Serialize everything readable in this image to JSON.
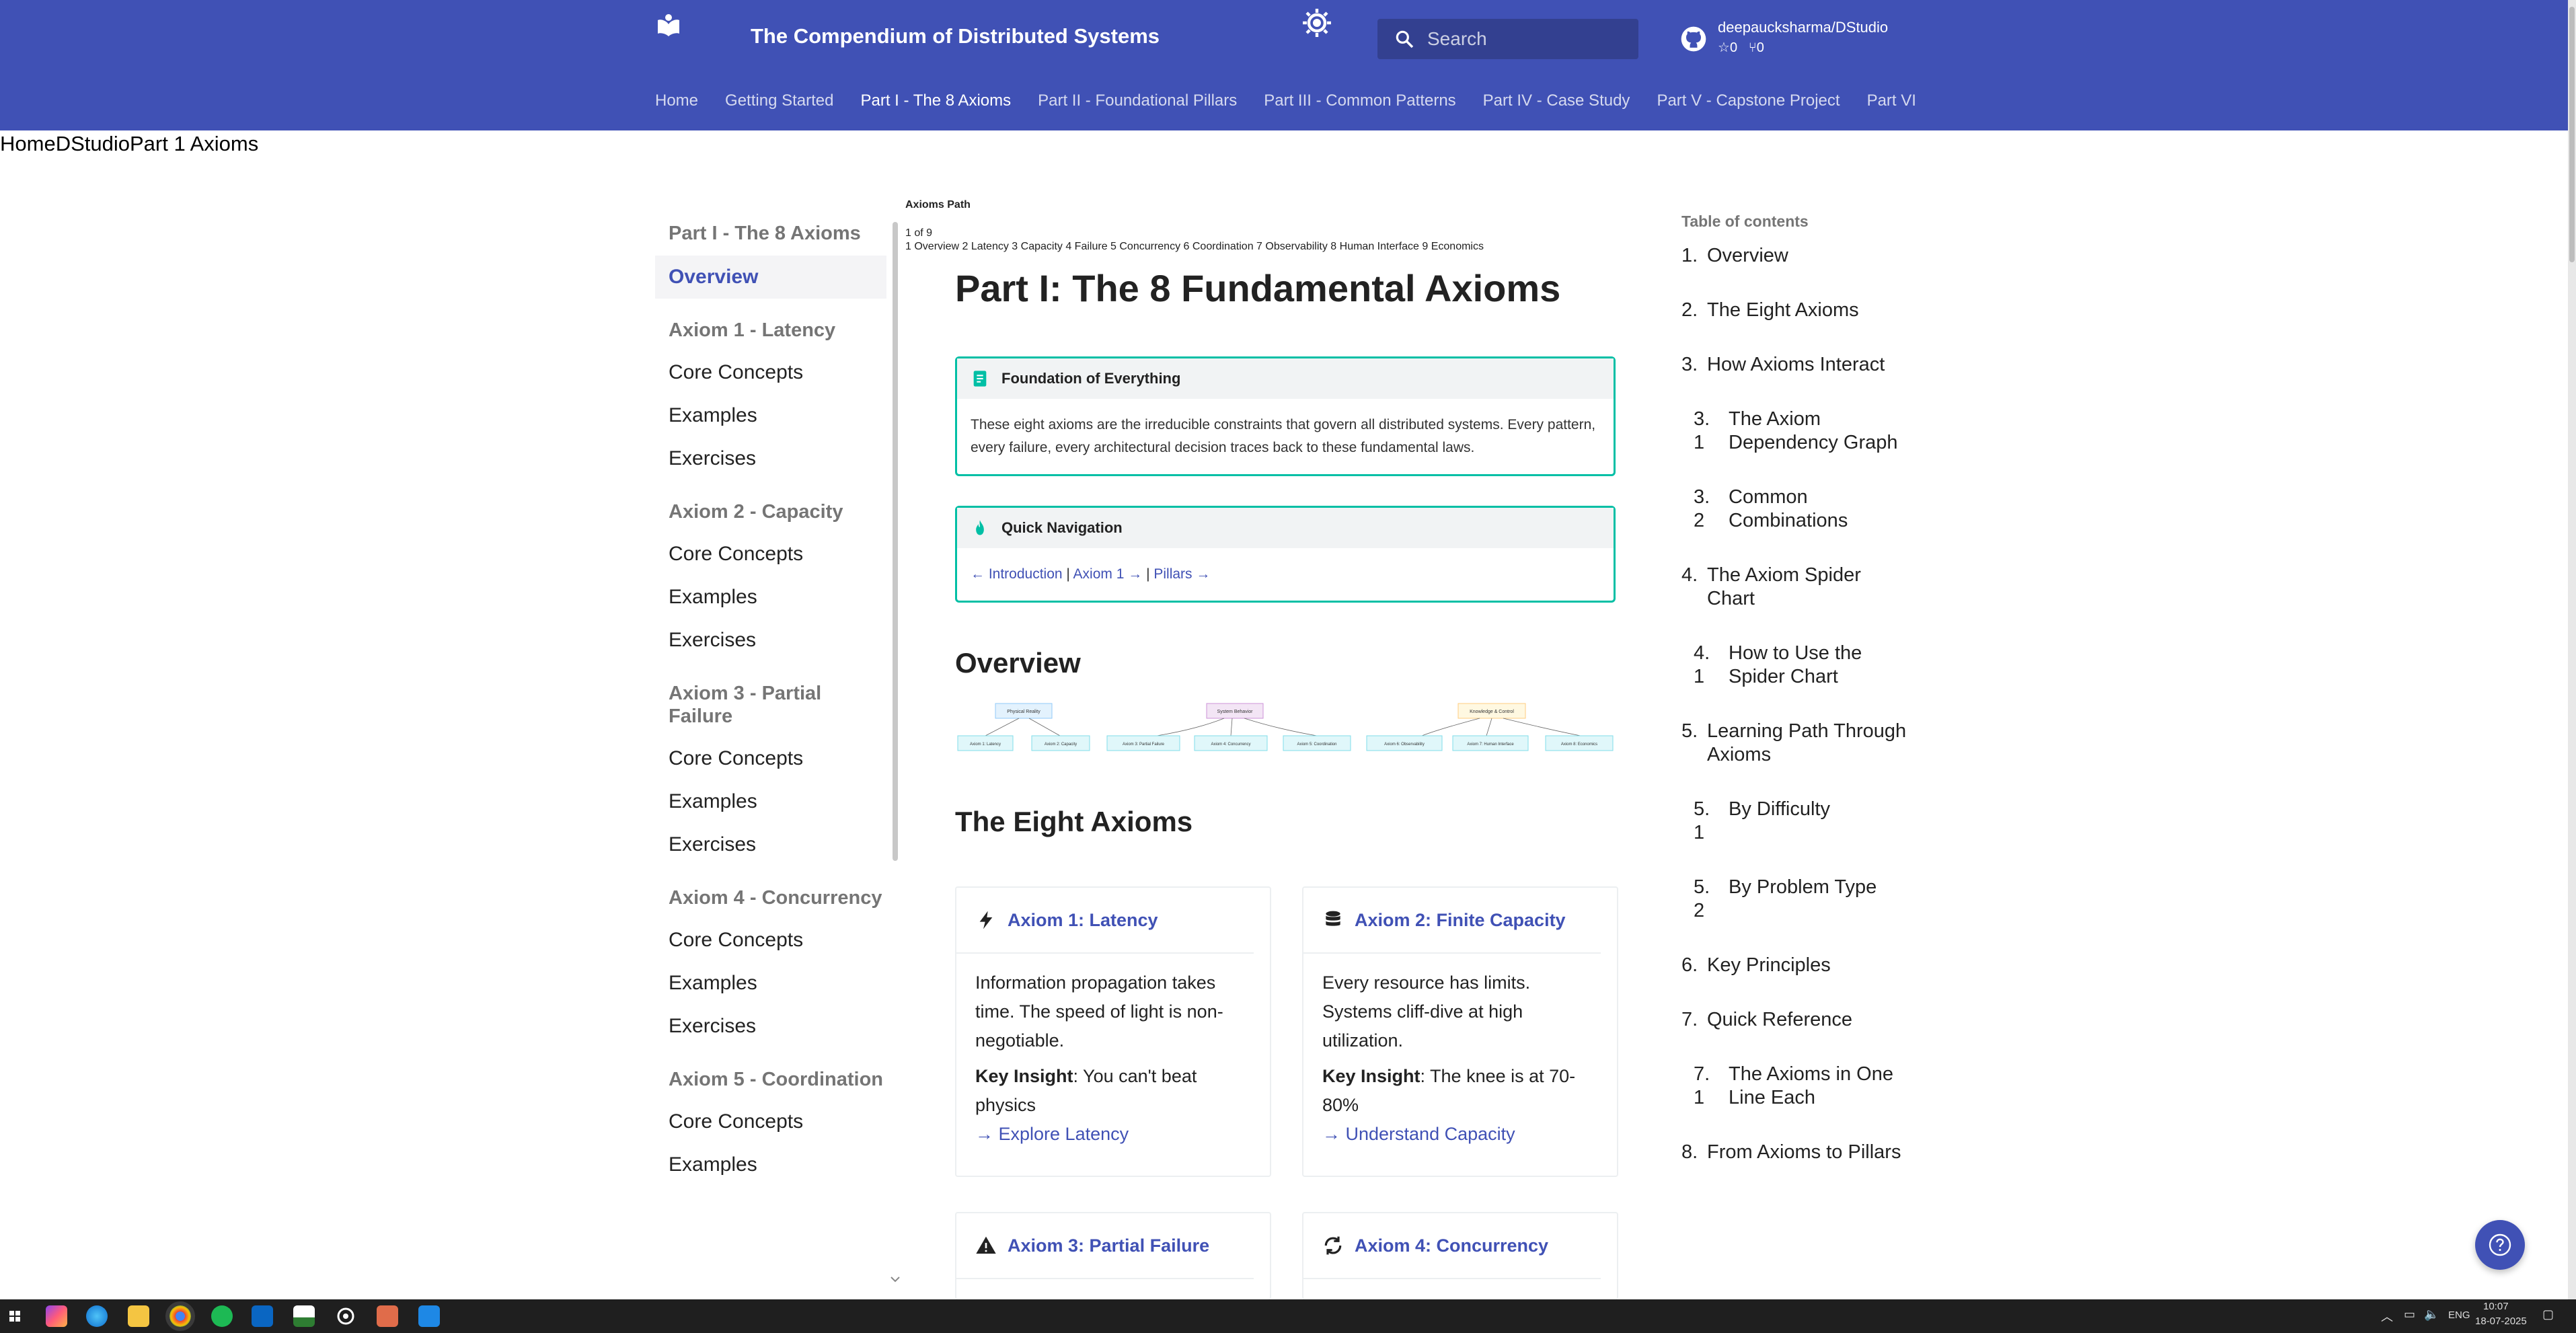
{
  "header": {
    "title": "The Compendium of Distributed Systems",
    "search_placeholder": "Search",
    "repo": {
      "name": "deepaucksharma/DStudio",
      "stars": "0",
      "forks": "0"
    }
  },
  "tabs": [
    {
      "label": "Home"
    },
    {
      "label": "Getting Started"
    },
    {
      "label": "Part I - The 8 Axioms"
    },
    {
      "label": "Part II - Foundational Pillars"
    },
    {
      "label": "Part III - Common Patterns"
    },
    {
      "label": "Part IV - Case Study"
    },
    {
      "label": "Part V - Capstone Project"
    },
    {
      "label": "Part VI"
    }
  ],
  "breadcrumb": "HomeDStudioPart 1 Axioms",
  "sidebar": {
    "section_title": "Part I - The 8 Axioms",
    "overview": "Overview",
    "groups": [
      {
        "title": "Axiom 1 - Latency",
        "items": [
          "Core Concepts",
          "Examples",
          "Exercises"
        ]
      },
      {
        "title": "Axiom 2 - Capacity",
        "items": [
          "Core Concepts",
          "Examples",
          "Exercises"
        ]
      },
      {
        "title": "Axiom 3 - Partial Failure",
        "items": [
          "Core Concepts",
          "Examples",
          "Exercises"
        ]
      },
      {
        "title": "Axiom 4 - Concurrency",
        "items": [
          "Core Concepts",
          "Examples",
          "Exercises"
        ]
      },
      {
        "title": "Axiom 5 - Coordination",
        "items": [
          "Core Concepts",
          "Examples"
        ]
      }
    ]
  },
  "axioms_path": {
    "label": "Axioms Path",
    "count": "1 of 9",
    "steps": "1 Overview 2 Latency 3 Capacity 4 Failure 5 Concurrency 6 Coordination 7 Observability 8 Human Interface 9 Economics"
  },
  "main": {
    "title": "Part I: The 8 Fundamental Axioms",
    "foundation": {
      "title": "Foundation of Everything",
      "body": "These eight axioms are the irreducible constraints that govern all distributed systems. Every pattern, every failure, every architectural decision traces back to these fundamental laws."
    },
    "quicknav": {
      "title": "Quick Navigation",
      "intro": "← Introduction",
      "sep1": " | ",
      "axiom1": "Axiom 1 →",
      "sep2": " | ",
      "pillars": "Pillars →"
    },
    "overview_heading": "Overview",
    "diagram": {
      "groups": [
        "Physical Reality",
        "System Behavior",
        "Knowledge & Control"
      ],
      "leaves": [
        "Axiom 1: Latency",
        "Axiom 2: Capacity",
        "Axiom 3: Partial Failure",
        "Axiom 4: Concurrency",
        "Axiom 5: Coordination",
        "Axiom 6: Observability",
        "Axiom 7: Human Interface",
        "Axiom 8: Economics"
      ]
    },
    "eight_heading": "The Eight Axioms",
    "cards": [
      {
        "title": "Axiom 1: Latency",
        "icon": "bolt-icon",
        "body": "Information propagation takes time. The speed of light is non-negotiable.",
        "insight_label": "Key Insight",
        "insight": ": You can't beat physics",
        "link": "→ Explore Latency"
      },
      {
        "title": "Axiom 2: Finite Capacity",
        "icon": "database-icon",
        "body": "Every resource has limits. Systems cliff-dive at high utilization.",
        "insight_label": "Key Insight",
        "insight": ": The knee is at 70-80%",
        "link": "→ Understand Capacity"
      },
      {
        "title": "Axiom 3: Partial Failure",
        "icon": "warning-icon"
      },
      {
        "title": "Axiom 4: Concurrency",
        "icon": "sync-icon"
      }
    ]
  },
  "toc": {
    "title": "Table of contents",
    "items": [
      {
        "num": "1.",
        "label": "Overview"
      },
      {
        "num": "2.",
        "label": "The Eight Axioms"
      },
      {
        "num": "3.",
        "label": "How Axioms Interact"
      },
      {
        "num": "3.1",
        "label": "The Axiom Dependency Graph"
      },
      {
        "num": "3.2",
        "label": "Common Combinations"
      },
      {
        "num": "4.",
        "label": "The Axiom Spider Chart"
      },
      {
        "num": "4.1",
        "label": "How to Use the Spider Chart"
      },
      {
        "num": "5.",
        "label": "Learning Path Through Axioms"
      },
      {
        "num": "5.1",
        "label": "By Difficulty"
      },
      {
        "num": "5.2",
        "label": "By Problem Type"
      },
      {
        "num": "6.",
        "label": "Key Principles"
      },
      {
        "num": "7.",
        "label": "Quick Reference"
      },
      {
        "num": "7.1",
        "label": "The Axioms in One Line Each"
      },
      {
        "num": "8.",
        "label": "From Axioms to Pillars"
      }
    ]
  },
  "taskbar": {
    "time": "10:07",
    "date": "18-07-2025",
    "lang": "ENG"
  },
  "colors": {
    "primary": "#4051b5",
    "accent": "#00bfa5",
    "taskbar": "#1f1f1f"
  }
}
